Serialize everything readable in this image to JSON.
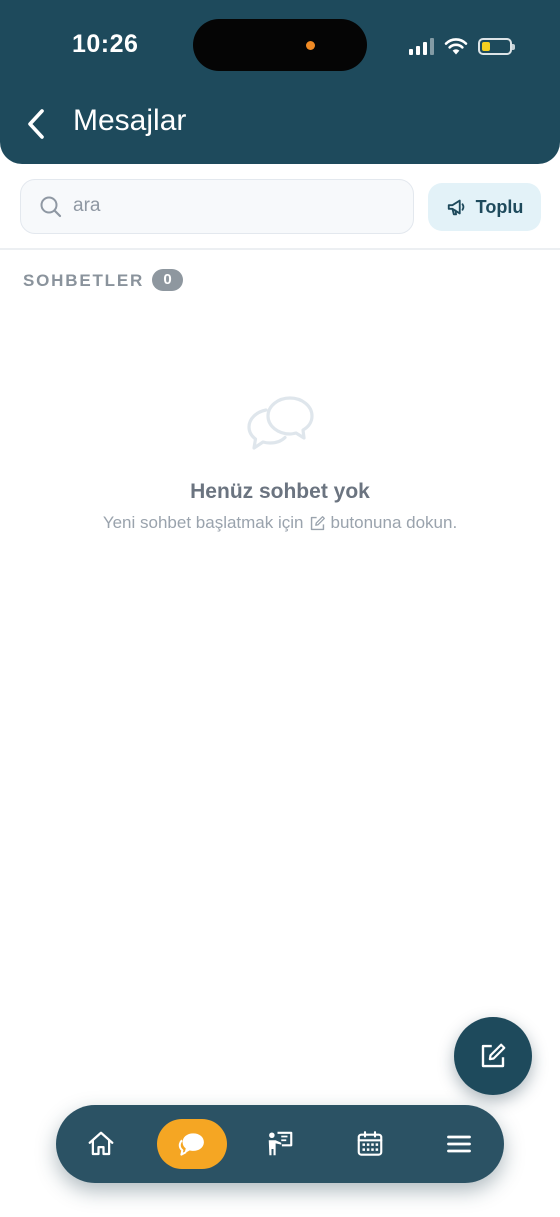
{
  "status_bar": {
    "time": "10:26",
    "battery_color": "#f5d020",
    "icons": [
      "signal-icon",
      "wifi-icon",
      "battery-icon"
    ]
  },
  "header": {
    "title": "Mesajlar",
    "back_icon": "chevron-left-icon",
    "background": "#1e4a5c"
  },
  "search": {
    "placeholder": "ara",
    "value": ""
  },
  "bulk_button": {
    "label": "Toplu",
    "icon": "megaphone-icon"
  },
  "section": {
    "title": "SOHBETLER",
    "count": "0"
  },
  "empty_state": {
    "icon": "chat-bubbles-icon",
    "title": "Henüz sohbet yok",
    "subtitle_before": "Yeni sohbet başlatmak için",
    "subtitle_after": "butonuna dokun."
  },
  "fab": {
    "icon": "compose-icon"
  },
  "bottom_nav": {
    "active_color": "#f5a623",
    "items": [
      {
        "name": "home",
        "icon": "home-icon",
        "active": false
      },
      {
        "name": "messages",
        "icon": "chat-icon",
        "active": true
      },
      {
        "name": "presentation",
        "icon": "presentation-icon",
        "active": false
      },
      {
        "name": "calendar",
        "icon": "calendar-icon",
        "active": false
      },
      {
        "name": "menu",
        "icon": "menu-icon",
        "active": false
      }
    ]
  }
}
